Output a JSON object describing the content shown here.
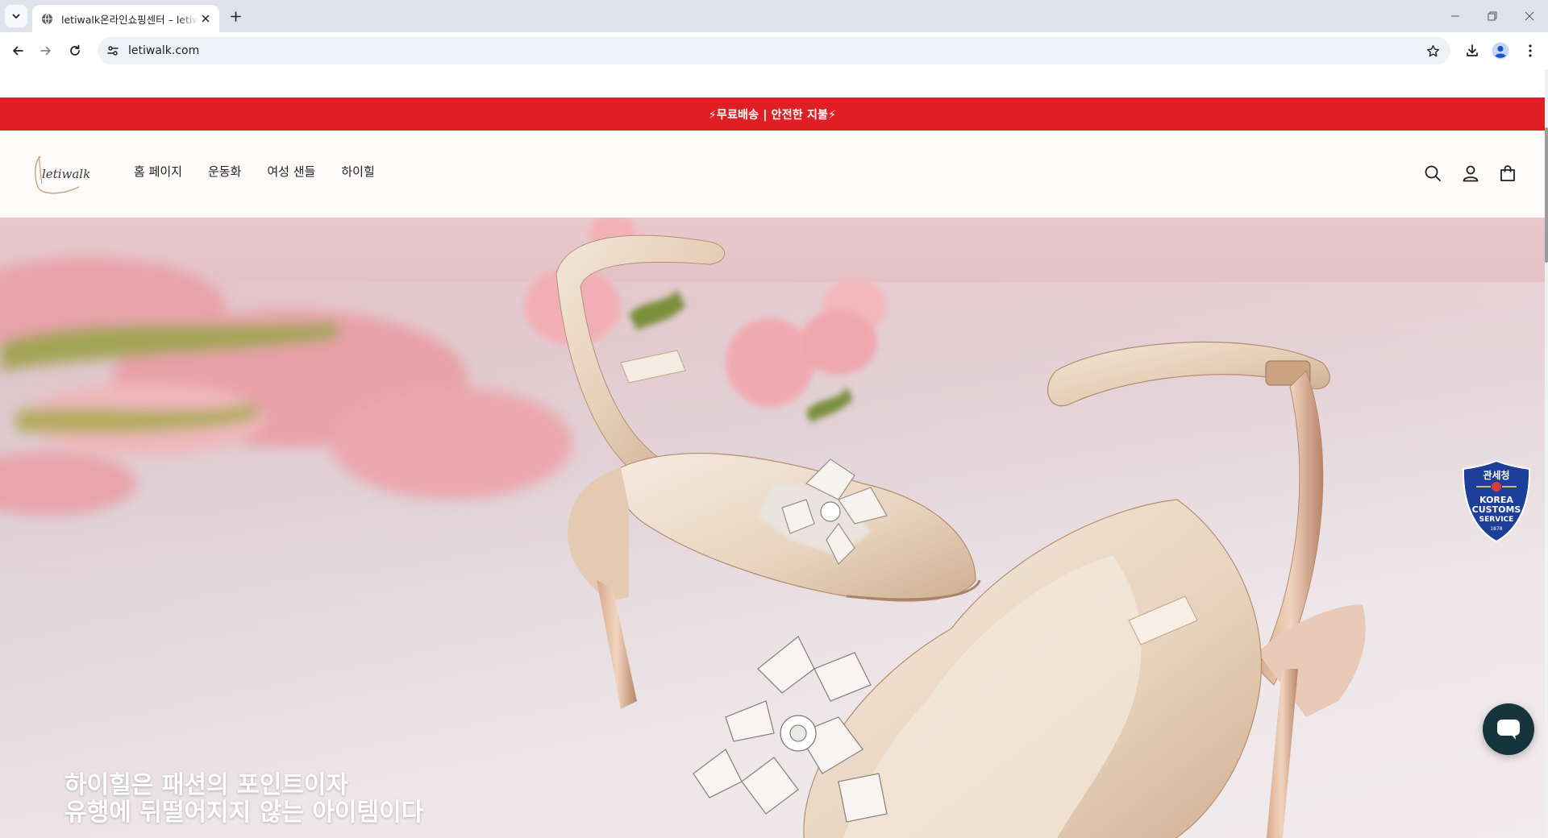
{
  "browser": {
    "tab_title": "letiwalk온라인쇼핑센터 – letiwalk",
    "url": "letiwalk.com"
  },
  "announcement": "⚡무료배송 | 안전한 지불⚡",
  "header": {
    "logo_text": "letiwalk",
    "nav": [
      "홈 페이지",
      "운동화",
      "여성 샌들",
      "하이힐"
    ]
  },
  "hero": {
    "headline_lines": [
      "하이힐은 패션의 포인트이자",
      "유행에 뒤떨어지지 않는 아이템이다"
    ]
  },
  "badge": {
    "top_text": "관세청",
    "line1": "KOREA",
    "line2": "CUSTOMS",
    "line3": "SERVICE",
    "year": "1878"
  },
  "colors": {
    "announcement_bg": "#e01f24",
    "header_bg": "#fdfbf9",
    "chat_button": "#16343b"
  },
  "icons": [
    "chevron-down-icon",
    "globe-icon",
    "close-icon",
    "plus-icon",
    "minimize-icon",
    "restore-icon",
    "back-icon",
    "forward-icon",
    "reload-icon",
    "site-info-icon",
    "star-icon",
    "download-icon",
    "profile-icon",
    "kebab-menu-icon",
    "search-icon",
    "account-icon",
    "cart-icon",
    "chat-icon"
  ]
}
